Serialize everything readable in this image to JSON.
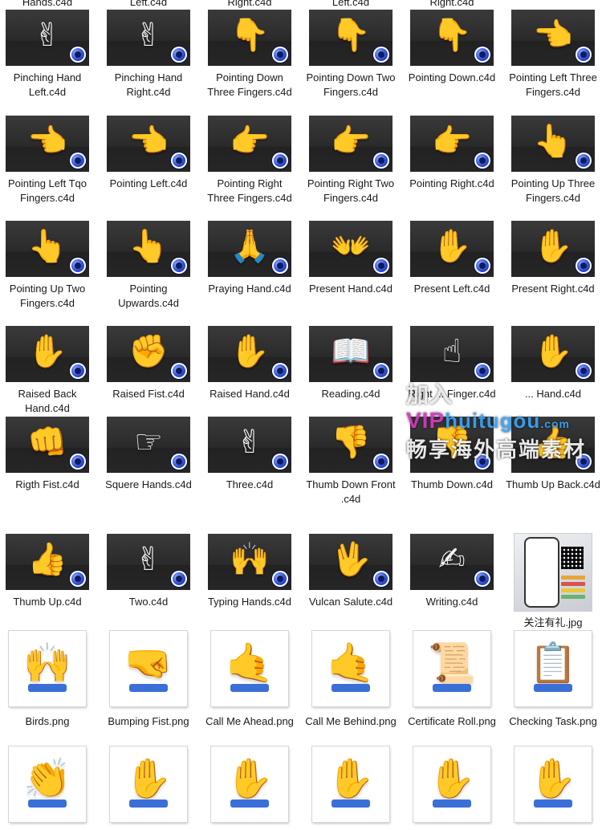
{
  "colors": {
    "c4d_thumb_bg": "#2b2b2b",
    "png_cuff": "#3b6fd8",
    "label_text": "#1a1a1a"
  },
  "top_partial_labels": [
    "Hands.c4d",
    "Left.c4d",
    "Right.c4d",
    "Left.c4d",
    "Right.c4d"
  ],
  "files": [
    {
      "name": "Pinching Hand Left.c4d",
      "kind": "c4d",
      "icon": "pinching-hand-icon"
    },
    {
      "name": "Pinching Hand Right.c4d",
      "kind": "c4d",
      "icon": "pinching-hand-icon"
    },
    {
      "name": "Pointing Down Three Fingers.c4d",
      "kind": "c4d",
      "icon": "pointing-down-hand-icon"
    },
    {
      "name": "Pointing Down Two Fingers.c4d",
      "kind": "c4d",
      "icon": "pointing-down-hand-icon"
    },
    {
      "name": "Pointing Down.c4d",
      "kind": "c4d",
      "icon": "pointing-down-hand-icon"
    },
    {
      "name": "Pointing Left Three Fingers.c4d",
      "kind": "c4d",
      "icon": "pointing-left-hand-icon"
    },
    {
      "name": "Pointing Left Tqo Fingers.c4d",
      "kind": "c4d",
      "icon": "pointing-left-hand-icon"
    },
    {
      "name": "Pointing Left.c4d",
      "kind": "c4d",
      "icon": "pointing-left-hand-icon"
    },
    {
      "name": "Pointing Right Three Fingers.c4d",
      "kind": "c4d",
      "icon": "pointing-right-hand-icon"
    },
    {
      "name": "Pointing Right Two Fingers.c4d",
      "kind": "c4d",
      "icon": "pointing-right-hand-icon"
    },
    {
      "name": "Pointing Right.c4d",
      "kind": "c4d",
      "icon": "pointing-right-hand-icon"
    },
    {
      "name": "Pointing Up Three Fingers.c4d",
      "kind": "c4d",
      "icon": "pointing-up-hand-icon"
    },
    {
      "name": "Pointing Up Two Fingers.c4d",
      "kind": "c4d",
      "icon": "pointing-up-hand-icon"
    },
    {
      "name": "Pointing Upwards.c4d",
      "kind": "c4d",
      "icon": "pointing-up-hand-icon"
    },
    {
      "name": "Praying Hand.c4d",
      "kind": "c4d",
      "icon": "praying-hands-icon"
    },
    {
      "name": "Present Hand.c4d",
      "kind": "c4d",
      "icon": "open-hands-icon"
    },
    {
      "name": "Present Left.c4d",
      "kind": "c4d",
      "icon": "open-hand-icon"
    },
    {
      "name": "Present Right.c4d",
      "kind": "c4d",
      "icon": "open-hand-icon"
    },
    {
      "name": "Raised Back Hand.c4d",
      "kind": "c4d",
      "icon": "raised-hand-icon"
    },
    {
      "name": "Raised Fist.c4d",
      "kind": "c4d",
      "icon": "raised-fist-icon"
    },
    {
      "name": "Raised Hand.c4d",
      "kind": "c4d",
      "icon": "raised-hand-icon"
    },
    {
      "name": "Reading.c4d",
      "kind": "c4d",
      "icon": "open-book-icon"
    },
    {
      "name": "Right ... Finger.c4d",
      "kind": "c4d",
      "icon": "pointing-hand-icon"
    },
    {
      "name": "... Hand.c4d",
      "kind": "c4d",
      "icon": "open-hand-icon"
    },
    {
      "name": "Rigth Fist.c4d",
      "kind": "c4d",
      "icon": "fist-icon"
    },
    {
      "name": "Squere Hands.c4d",
      "kind": "c4d",
      "icon": "frame-hands-icon"
    },
    {
      "name": "Three.c4d",
      "kind": "c4d",
      "icon": "three-fingers-icon"
    },
    {
      "name": "Thumb Down Front .c4d",
      "kind": "c4d",
      "icon": "thumb-down-icon"
    },
    {
      "name": "Thumb Down.c4d",
      "kind": "c4d",
      "icon": "thumb-down-icon"
    },
    {
      "name": "Thumb Up Back.c4d",
      "kind": "c4d",
      "icon": "thumb-up-icon"
    },
    {
      "name": "Thumb Up.c4d",
      "kind": "c4d",
      "icon": "thumb-up-icon"
    },
    {
      "name": "Two.c4d",
      "kind": "c4d",
      "icon": "victory-hand-icon"
    },
    {
      "name": "Typing Hands.c4d",
      "kind": "c4d",
      "icon": "typing-hands-icon"
    },
    {
      "name": "Vulcan Salute.c4d",
      "kind": "c4d",
      "icon": "vulcan-salute-icon"
    },
    {
      "name": "Writing.c4d",
      "kind": "c4d",
      "icon": "writing-hand-icon"
    },
    {
      "name": "关注有礼.jpg",
      "kind": "jpg",
      "icon": "promo-poster-icon"
    },
    {
      "name": "Birds.png",
      "kind": "png",
      "icon": "crossed-hands-icon"
    },
    {
      "name": "Bumping Fist.png",
      "kind": "png",
      "icon": "fist-bump-icon"
    },
    {
      "name": "Call Me Ahead.png",
      "kind": "png",
      "icon": "call-me-hand-icon"
    },
    {
      "name": "Call Me Behind.png",
      "kind": "png",
      "icon": "call-me-hand-icon"
    },
    {
      "name": "Certificate Roll.png",
      "kind": "png",
      "icon": "certificate-roll-icon"
    },
    {
      "name": "Checking Task.png",
      "kind": "png",
      "icon": "clipboard-check-icon"
    },
    {
      "name": "",
      "kind": "png",
      "icon": "clapping-hand-icon"
    },
    {
      "name": "",
      "kind": "png",
      "icon": "hand-icon"
    },
    {
      "name": "",
      "kind": "png",
      "icon": "hand-icon"
    },
    {
      "name": "",
      "kind": "png",
      "icon": "hand-icon"
    },
    {
      "name": "",
      "kind": "png",
      "icon": "hand-icon"
    },
    {
      "name": "",
      "kind": "png",
      "icon": "hand-icon"
    }
  ],
  "watermark": {
    "line1_a": "加入",
    "line1_vip": "VIP",
    "line1_site": "huitugou",
    "line1_dot": ".com",
    "line2": "畅享海外高端素材"
  }
}
